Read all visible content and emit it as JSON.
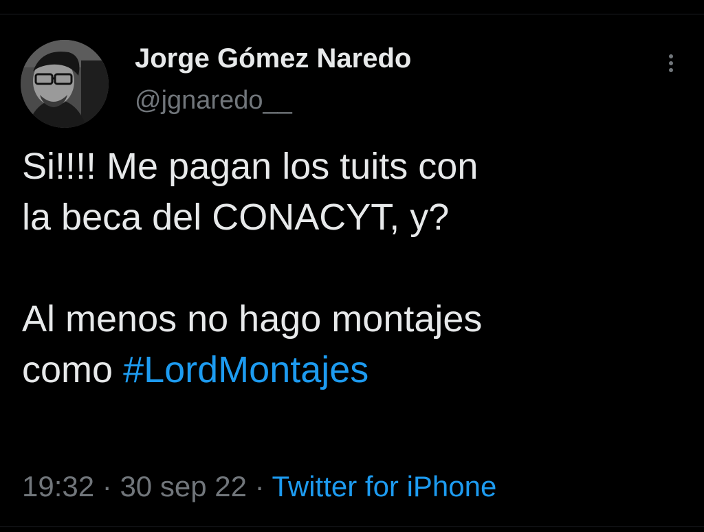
{
  "tweet": {
    "author": {
      "display_name": "Jorge Gómez Naredo",
      "handle": "@jgnaredo__",
      "avatar_icon": "profile-photo-avatar"
    },
    "more_icon": "vertical-ellipsis-icon",
    "text_lines": [
      "Si!!!! Me pagan los tuits con",
      "la beca del CONACYT, y?",
      "",
      "Al menos no hago montajes",
      "como "
    ],
    "hashtag": "#LordMontajes",
    "time": "19:32",
    "separator": "·",
    "date": "30 sep 22",
    "source": "Twitter for iPhone"
  },
  "colors": {
    "background": "#000000",
    "text_primary": "#e7e9ea",
    "text_secondary": "#71767b",
    "link": "#1d9bf0"
  }
}
